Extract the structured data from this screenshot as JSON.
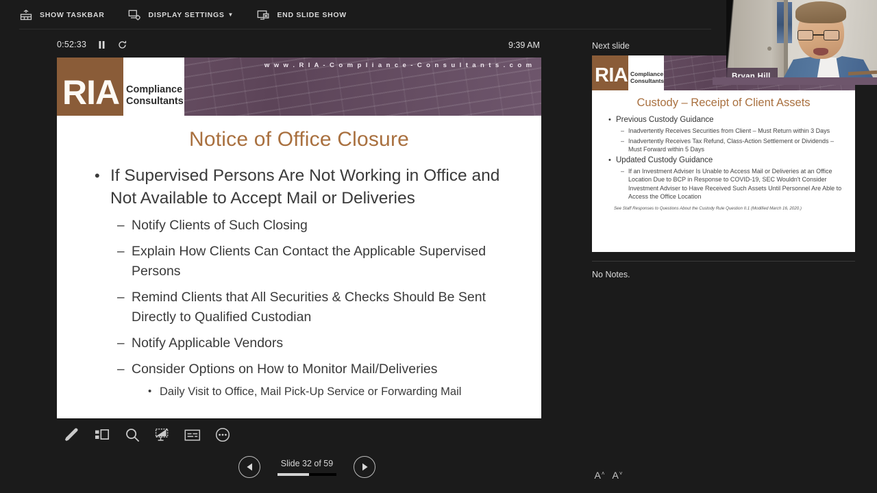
{
  "toolbar": {
    "items": [
      {
        "label": "SHOW TASKBAR",
        "icon": "taskbar-icon",
        "caret": ""
      },
      {
        "label": "DISPLAY SETTINGS",
        "icon": "display-settings-icon",
        "caret": "▼"
      },
      {
        "label": "END SLIDE SHOW",
        "icon": "end-slideshow-icon",
        "caret": ""
      }
    ]
  },
  "timer": {
    "elapsed": "0:52:33",
    "pause_icon": "❙❙",
    "reset_icon": "↻",
    "clock": "9:39 AM"
  },
  "slide": {
    "banner": {
      "logo_primary": "RIA",
      "logo_secondary_line1": "Compliance",
      "logo_secondary_line2": "Consultants",
      "url": "w w w . R I A - C o m p l i a n c e - C o n s u l t a n t s . c o m",
      "brown": "#8a5c38",
      "purple": "#6a5068"
    },
    "title": "Notice of Office Closure",
    "title_color": "#a9703f",
    "bullets": {
      "l1": "If Supervised Persons Are Not Working in Office and Not Available to Accept Mail or Deliveries",
      "l2_1": "Notify Clients of Such Closing",
      "l2_2": "Explain How Clients Can Contact the Applicable Supervised Persons",
      "l2_3": "Remind Clients that All Securities & Checks Should Be Sent Directly to Qualified Custodian",
      "l2_4": "Notify Applicable Vendors",
      "l2_5": "Consider Options on How to Monitor Mail/Deliveries",
      "l3_1": "Daily Visit to Office, Mail Pick-Up Service or Forwarding Mail"
    },
    "bullet_marks": {
      "level1": "•",
      "level2": "–",
      "level3": "•"
    }
  },
  "icon_bar": {
    "items": [
      {
        "name": "pen-icon",
        "label": "Pen"
      },
      {
        "name": "all-slides-icon",
        "label": "See all slides"
      },
      {
        "name": "zoom-icon",
        "label": "Zoom into slide"
      },
      {
        "name": "blank-screen-icon",
        "label": "Black or unblack slide show"
      },
      {
        "name": "captions-icon",
        "label": "Toggle subtitles"
      },
      {
        "name": "more-options-icon",
        "label": "More slide show options"
      }
    ]
  },
  "navigation": {
    "previous_icon": "◀",
    "next_icon": "▶",
    "slide_counter": "Slide 32 of 59",
    "current_slide": 32,
    "total_slides": 59,
    "progress_percent": 54
  },
  "next_slide": {
    "label": "Next slide",
    "banner": {
      "logo_primary": "RIA",
      "logo_secondary_line1": "Compliance",
      "logo_secondary_line2": "Consultants"
    },
    "title": "Custody – Receipt of Client Assets",
    "bullets": [
      {
        "level": 1,
        "text": "Previous Custody Guidance"
      },
      {
        "level": 2,
        "text": "Inadvertently Receives Securities from Client – Must Return within 3 Days"
      },
      {
        "level": 2,
        "text": "Inadvertently Receives Tax Refund, Class-Action Settlement or Dividends – Must Forward within 5 Days"
      },
      {
        "level": 1,
        "text": "Updated Custody Guidance"
      },
      {
        "level": 2,
        "text": "If an Investment Adviser Is Unable to Access Mail or Deliveries at an Office Location Due to BCP in Response to COVID-19, SEC Wouldn't Consider Investment Adviser to Have Received Such Assets Until Personnel Are Able to Access the Office Location"
      }
    ],
    "footnote": "See Staff Responses to Questions About the Custody Rule Question II.1 (Modified March 16, 2020.)",
    "bullet_marks": {
      "level1": "•",
      "level2": "–"
    }
  },
  "notes": {
    "text": "No Notes.",
    "increase_font_label": "A",
    "increase_font_arrow": "˄",
    "decrease_font_label": "A",
    "decrease_font_arrow": "˅"
  },
  "webcam": {
    "participant_name": "Bryan Hill"
  }
}
